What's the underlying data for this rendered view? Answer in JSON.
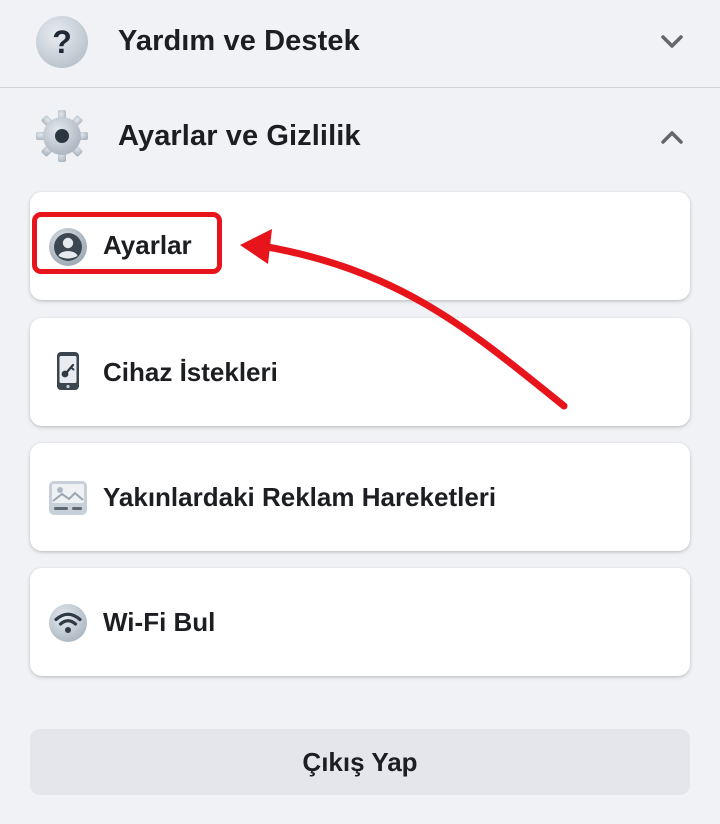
{
  "sections": {
    "help": {
      "label": "Yardım ve Destek",
      "icon": "question-icon",
      "expanded": false
    },
    "settings": {
      "label": "Ayarlar ve Gizlilik",
      "icon": "gear-icon",
      "expanded": true
    }
  },
  "items": [
    {
      "label": "Ayarlar",
      "icon": "profile-icon",
      "highlighted": true
    },
    {
      "label": "Cihaz İstekleri",
      "icon": "device-key-icon"
    },
    {
      "label": "Yakınlardaki Reklam Hareketleri",
      "icon": "ad-image-icon"
    },
    {
      "label": "Wi-Fi Bul",
      "icon": "wifi-icon"
    }
  ],
  "logout": {
    "label": "Çıkış Yap"
  },
  "annotation": {
    "color": "#e8141b"
  }
}
